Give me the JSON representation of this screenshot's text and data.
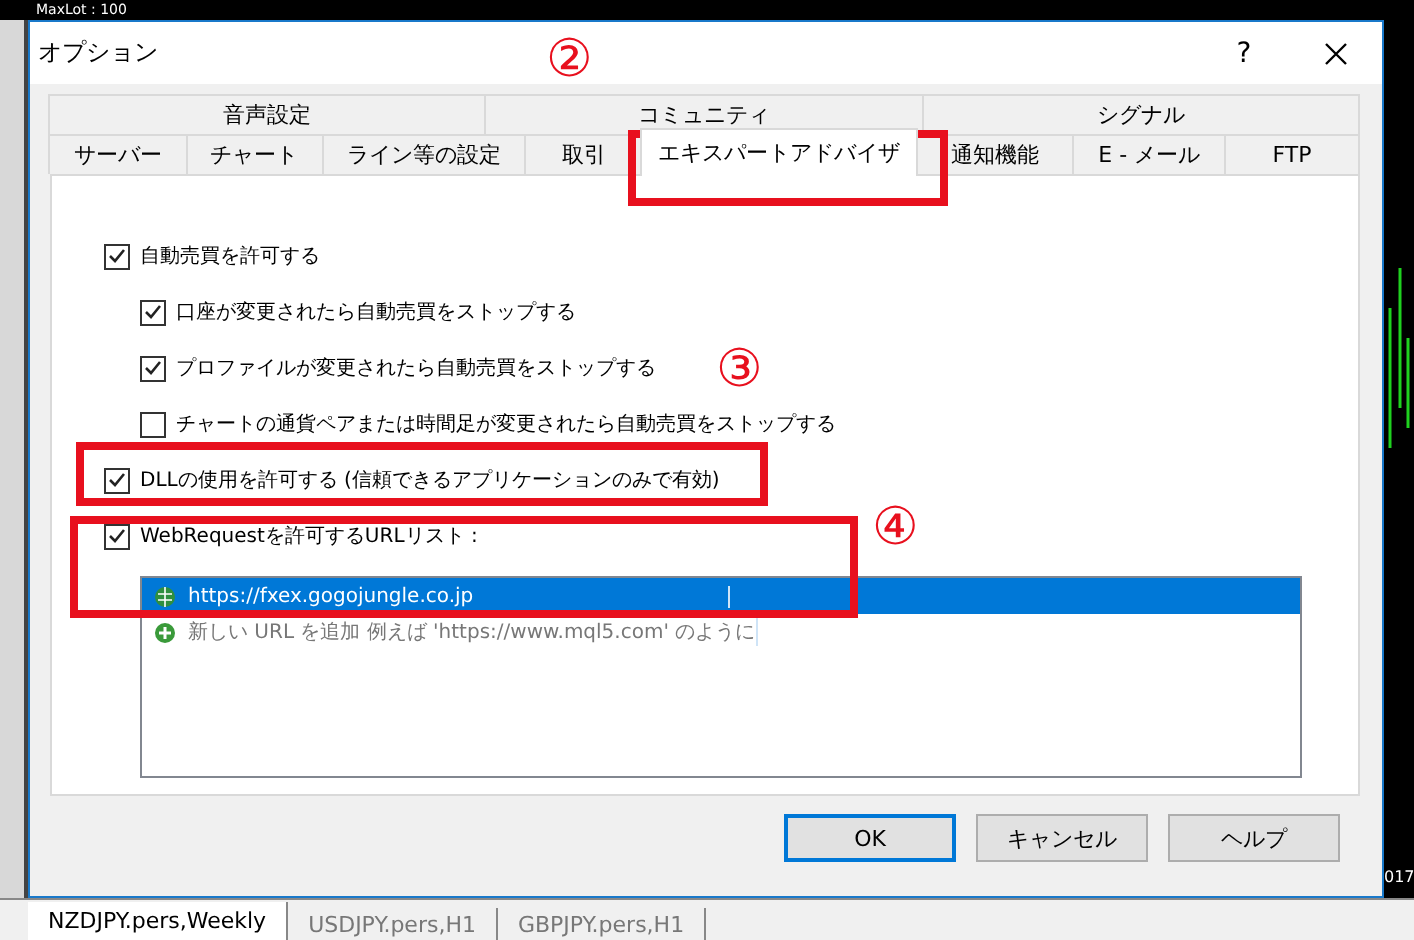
{
  "background": {
    "chart_label": "MaxLot : 100",
    "date_fragment": "017"
  },
  "window": {
    "title": "オプション",
    "help": "?"
  },
  "tabs": {
    "upper": [
      {
        "label": "音声設定",
        "selected": false
      },
      {
        "label": "コミュニティ",
        "selected": false
      },
      {
        "label": "シグナル",
        "selected": false
      }
    ],
    "lower": [
      {
        "label": "サーバー",
        "selected": false
      },
      {
        "label": "チャート",
        "selected": false
      },
      {
        "label": "ライン等の設定",
        "selected": false
      },
      {
        "label": "取引",
        "selected": false
      },
      {
        "label": "エキスパートアドバイザ",
        "selected": true
      },
      {
        "label": "通知機能",
        "selected": false
      },
      {
        "label": "E - メール",
        "selected": false
      },
      {
        "label": "FTP",
        "selected": false
      }
    ]
  },
  "options": [
    {
      "label": "自動売買を許可する",
      "checked": true,
      "children": [
        {
          "label": "口座が変更されたら自動売買をストップする",
          "checked": true
        },
        {
          "label": "プロファイルが変更されたら自動売買をストップする",
          "checked": true
        },
        {
          "label": "チャートの通貨ペアまたは時間足が変更されたら自動売買をストップする",
          "checked": false
        }
      ]
    },
    {
      "label": "DLLの使用を許可する (信頼できるアプリケーションのみで有効)",
      "checked": true
    },
    {
      "label": "WebRequestを許可するURLリスト :",
      "checked": true
    }
  ],
  "url_list": [
    {
      "text": "https://fxex.gogojungle.co.jp",
      "selected": true,
      "kind": "url"
    },
    {
      "text": "新しい URL を追加 例えば 'https://www.mql5.com' のように",
      "selected": false,
      "kind": "add"
    }
  ],
  "buttons": [
    {
      "label": "OK",
      "selected": true
    },
    {
      "label": "キャンセル",
      "selected": false
    },
    {
      "label": "ヘルプ",
      "selected": false
    }
  ],
  "annotations": [
    {
      "label": "②"
    },
    {
      "label": "③"
    },
    {
      "label": "④"
    }
  ],
  "chart_tabs": [
    {
      "label": "NZDJPY.pers,Weekly",
      "selected": true
    },
    {
      "label": "USDJPY.pers,H1",
      "selected": false
    },
    {
      "label": "GBPJPY.pers,H1",
      "selected": false
    }
  ]
}
